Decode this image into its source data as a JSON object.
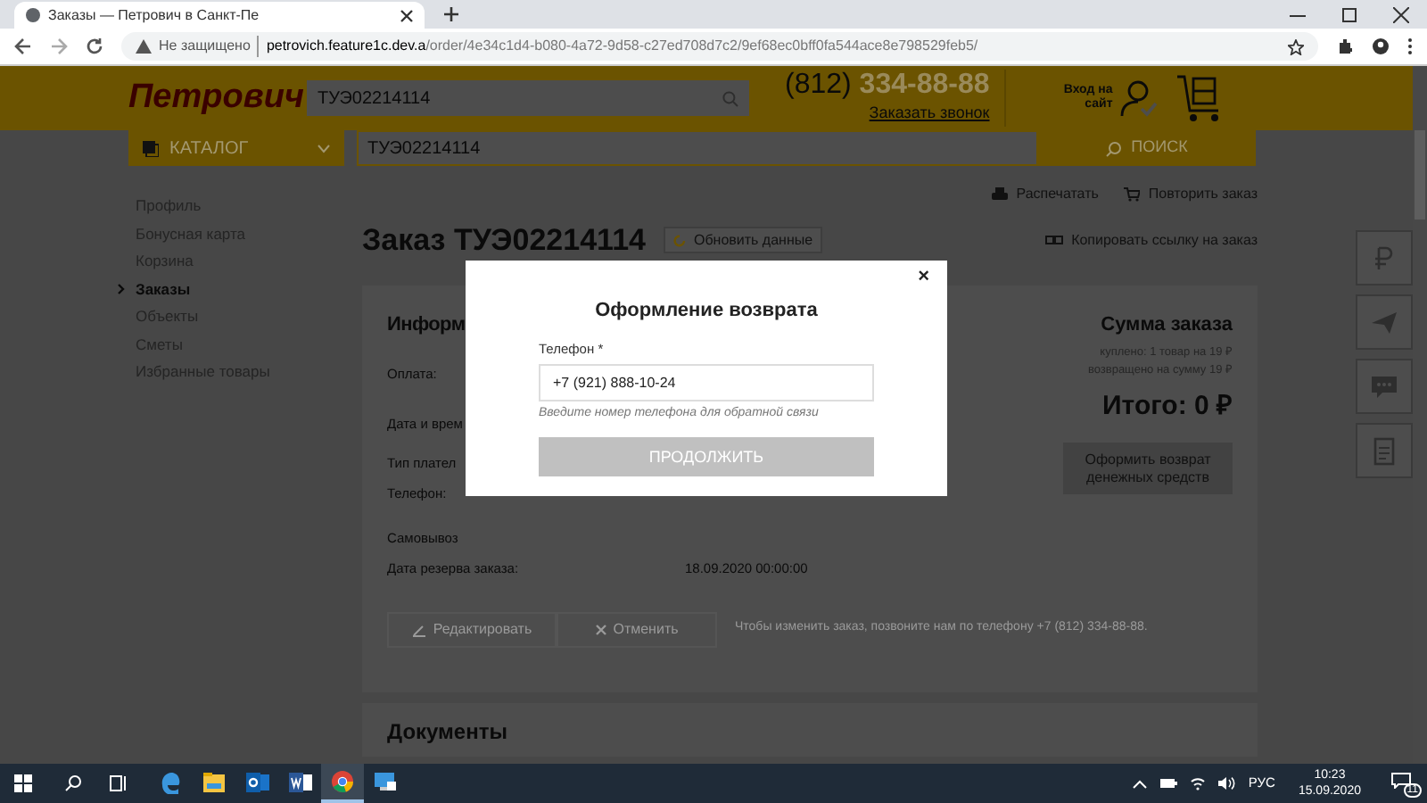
{
  "browser": {
    "tab_title": "Заказы — Петрович в Санкт-Пе",
    "insecure_label": "Не защищено",
    "url_host": "petrovich.feature1c.dev.a",
    "url_path": "/order/4e34c1d4-b080-4a72-9d58-c27ed708d7c2/9ef68ec0bff0fa544ace8e798529feb5/"
  },
  "header": {
    "logo": "Петрович",
    "search_value": "ТУЭ02214114",
    "phone_code": "(812)",
    "phone_number": "334-88-88",
    "callback": "Заказать звонок",
    "login": "Вход на сайт"
  },
  "nav": {
    "catalog": "КАТАЛОГ",
    "search_value": "ТУЭ02214114",
    "search_button": "ПОИСК"
  },
  "sidebar": {
    "items": [
      {
        "label": "Профиль",
        "selected": false
      },
      {
        "label": "Бонусная карта",
        "selected": false
      },
      {
        "label": "Корзина",
        "selected": false
      },
      {
        "label": "Заказы",
        "selected": true
      },
      {
        "label": "Объекты",
        "selected": false
      },
      {
        "label": "Сметы",
        "selected": false
      },
      {
        "label": "Избранные товары",
        "selected": false
      }
    ]
  },
  "order": {
    "title": "Заказ ТУЭ02214114",
    "refresh": "Обновить данные",
    "print": "Распечатать",
    "repeat": "Повторить заказ",
    "copy_link": "Копировать ссылку на заказ"
  },
  "info": {
    "heading": "Информ",
    "rows": [
      {
        "label": "Оплата:"
      },
      {
        "label": "Дата и врем"
      },
      {
        "label": "Тип плател"
      },
      {
        "label": "Телефон:"
      },
      {
        "label": "Самовывоз"
      },
      {
        "label": "Дата резерва заказа:",
        "value": "18.09.2020 00:00:00"
      }
    ]
  },
  "summary": {
    "title": "Сумма заказа",
    "bought": "куплено: 1 товар на 19 ₽",
    "returned": "возвращено на сумму 19 ₽",
    "total": "Итого: 0 ₽",
    "refund_button": "Оформить возврат денежных средств"
  },
  "actions": {
    "edit": "Редактировать",
    "cancel": "Отменить",
    "note": "Чтобы изменить заказ, позвоните нам по телефону +7 (812) 334-88-88."
  },
  "documents_heading": "Документы",
  "side_buttons": [
    {
      "kind": "ruble"
    },
    {
      "kind": "send"
    },
    {
      "kind": "chat"
    },
    {
      "kind": "document"
    }
  ],
  "modal": {
    "title": "Оформление возврата",
    "close": "×",
    "phone_label": "Телефон *",
    "phone_value": "+7 (921) 888-10-24",
    "hint": "Введите номер телефона для обратной связи",
    "button": "ПРОДОЛЖИТЬ",
    "disabled": true
  },
  "taskbar": {
    "apps": [
      {
        "kind": "edge",
        "selected": false
      },
      {
        "kind": "explorer",
        "selected": false
      },
      {
        "kind": "outlook",
        "selected": false
      },
      {
        "kind": "word",
        "selected": false
      },
      {
        "kind": "chrome",
        "selected": true
      },
      {
        "kind": "remote",
        "selected": false
      }
    ],
    "language": "РУС",
    "time": "10:23",
    "date": "15.09.2020",
    "notifications": "11"
  }
}
